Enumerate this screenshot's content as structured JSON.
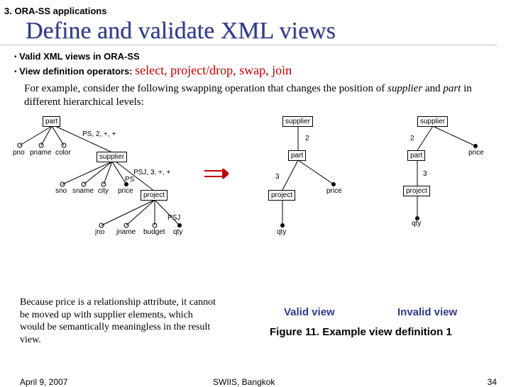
{
  "breadcrumb": "3. ORA-SS applications",
  "title": "Define and validate XML views",
  "bullet1_pre": "Valid XML views in ORA-SS",
  "bullet2_pre": "View definition operators: ",
  "bullet2_ops": "select,  project/drop,  swap,  join",
  "para_pre": "For example, consider the following swapping operation that changes the position of ",
  "para_it1": "supplier",
  "para_mid": " and ",
  "para_it2": "part",
  "para_post": " in different hierarchical levels:",
  "left": {
    "part": "part",
    "supplier": "supplier",
    "project": "project",
    "ann_ps": "PS, 2, +, +",
    "ann_psj": "PSJ, 3, +, +",
    "pno": "pno",
    "pname": "pname",
    "color": "color",
    "sno": "sno",
    "sname": "sname",
    "city": "city",
    "price": "price",
    "ps": "PS",
    "jno": "jno",
    "jname": "jname",
    "budget": "budget",
    "qty": "qty",
    "psj": "PSJ"
  },
  "r1": {
    "supplier": "supplier",
    "part": "part",
    "project": "project",
    "price": "price",
    "qty": "qty",
    "n2": "2",
    "n3": "3"
  },
  "r2": {
    "supplier": "supplier",
    "part": "part",
    "price": "price",
    "project": "project",
    "qty": "qty",
    "n2": "2",
    "n3": "3"
  },
  "valid": "Valid view",
  "invalid": "Invalid view",
  "note": "Because price is a relationship attribute, it cannot be moved up with supplier elements, which would be semantically meaningless in the result view.",
  "figcap": "Figure 11. Example view definition 1",
  "date": "April 9, 2007",
  "venue": "SWIIS, Bangkok",
  "page": "34"
}
